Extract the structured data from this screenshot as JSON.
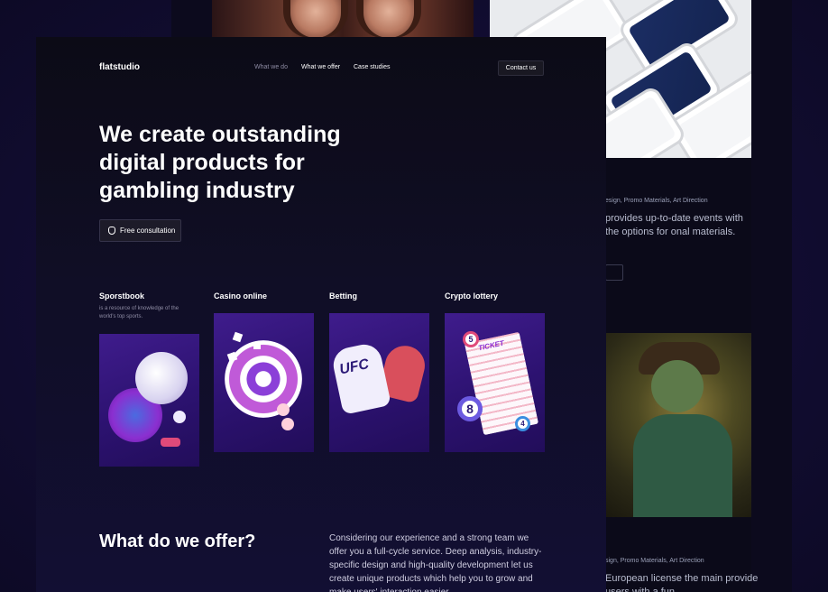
{
  "header": {
    "logo": "flatstudio",
    "nav": [
      "What we do",
      "What we offer",
      "Case studies"
    ],
    "contact_label": "Contact us"
  },
  "hero": {
    "title": "We create outstanding digital products for gambling industry",
    "cta_label": "Free consultation"
  },
  "categories": [
    {
      "title": "Sporstbook",
      "desc": "is a resource of knowledge of the world's top sports."
    },
    {
      "title": "Casino online",
      "desc": ""
    },
    {
      "title": "Betting",
      "desc": ""
    },
    {
      "title": "Crypto lottery",
      "desc": ""
    }
  ],
  "offer": {
    "title": "What do we offer?",
    "copy": "Considering our experience and a strong team we offer you a full-cycle service. Deep analysis, industry-specific design and high-quality development let us create unique products which help you to grow and make users' interaction easier."
  },
  "right_panel": {
    "meta_1": "esign, Promo Materials, Art Direction",
    "copy_1": "provides up-to-date events with the options for onal materials.",
    "meta_2": "sign, Promo Materials, Art Direction",
    "copy_2": "European license the main provide users with a fun"
  },
  "card_art": {
    "ufc": "UFC",
    "ticket": "TICKET",
    "ball_5": "5",
    "ball_8": "8",
    "ball_4": "4"
  },
  "colors": {
    "background": "#110c2e",
    "card": "#2c1270",
    "accent_pink": "#e04a7a"
  }
}
